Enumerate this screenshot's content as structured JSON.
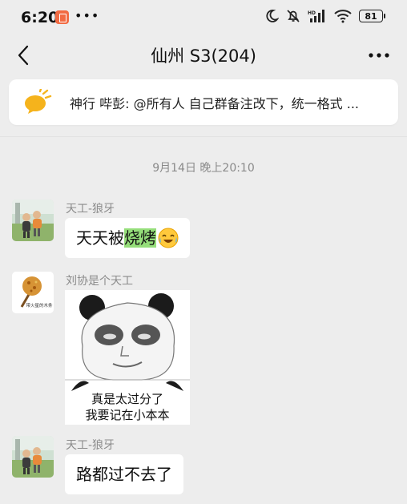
{
  "status": {
    "time": "6:20",
    "dots": "•••",
    "battery": "81"
  },
  "nav": {
    "title": "仙州 S3(204)"
  },
  "notice": {
    "text": "神行 哔彭: @所有人 自己群备注改下，统一格式 ..."
  },
  "timestamp": "9月14日 晚上20:10",
  "messages": [
    {
      "sender": "天工-狼牙",
      "pre": "天天被",
      "highlight": "烧烤"
    },
    {
      "sender": "刘协是个天工",
      "avatar_caption": "带火星的木条",
      "caption_line1": "真是太过分了",
      "caption_line2": "我要记在小本本"
    },
    {
      "sender": "天工-狼牙",
      "text": "路都过不去了"
    }
  ],
  "colors": {
    "accent_notice": "#f5b31c",
    "highlight": "#95de7a",
    "background": "#ededed"
  },
  "icons": [
    "back-icon",
    "more-icon",
    "megaphone-icon",
    "moon-icon",
    "muted-bell-icon",
    "signal-icon",
    "wifi-icon",
    "battery-icon",
    "crying-laughing-emoji"
  ]
}
